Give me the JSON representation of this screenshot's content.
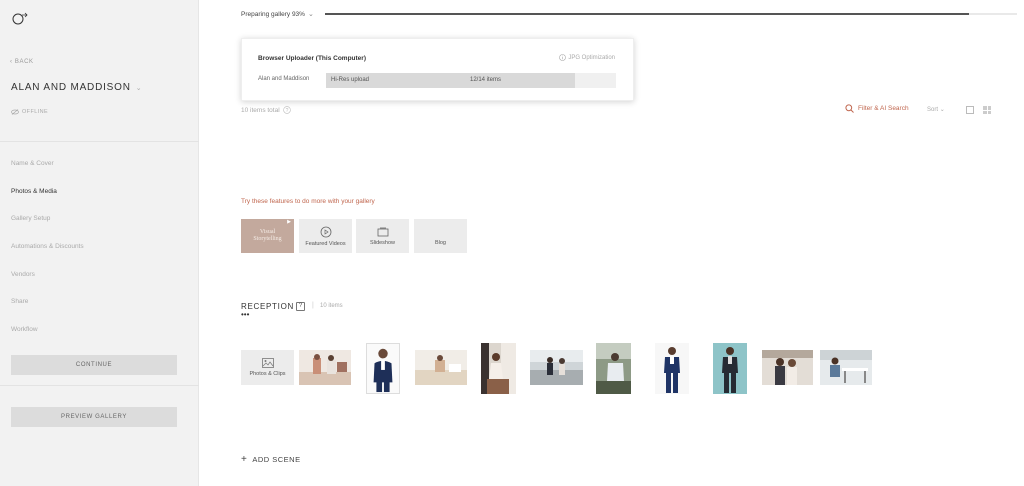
{
  "sidebar": {
    "back": "‹ BACK",
    "gallery_name": "ALAN AND MADDISON",
    "status": "OFFLINE",
    "nav": [
      "Name & Cover",
      "Photos & Media",
      "Gallery Setup",
      "Automations & Discounts",
      "Vendors",
      "Share",
      "Workflow"
    ],
    "active_item": "Photos & Media",
    "continue_label": "CONTINUE",
    "preview_label": "PREVIEW GALLERY"
  },
  "progress": {
    "label": "Preparing gallery 93%",
    "percent": 93
  },
  "uploader": {
    "title": "Browser Uploader (This Computer)",
    "jpg_label": "JPG Optimization",
    "gallery": "Alan and Maddison",
    "upload_label": "Hi-Res upload",
    "count": "12/14 items",
    "progress": 0.857
  },
  "toolbar": {
    "items_total": "10 items total",
    "filter_label": "Filter & AI Search",
    "sort_label": "Sort"
  },
  "features": {
    "heading": "Try these features to do more with your gallery",
    "items": [
      {
        "label": "Visual Storytelling",
        "icon": "play-icon"
      },
      {
        "label": "Featured Videos",
        "icon": "play-circle-icon"
      },
      {
        "label": "Slideshow",
        "icon": "slideshow-icon"
      },
      {
        "label": "Blog",
        "icon": "none"
      }
    ]
  },
  "scene": {
    "name": "RECEPTION",
    "count": "10 items",
    "more": "•••",
    "photos_tile": "Photos & Clips",
    "add_scene": "ADD SCENE"
  },
  "colors": {
    "accent": "#c0664e",
    "sidebar_bg": "#f2f2f2",
    "storytelling_tile": "#c3a99d"
  }
}
